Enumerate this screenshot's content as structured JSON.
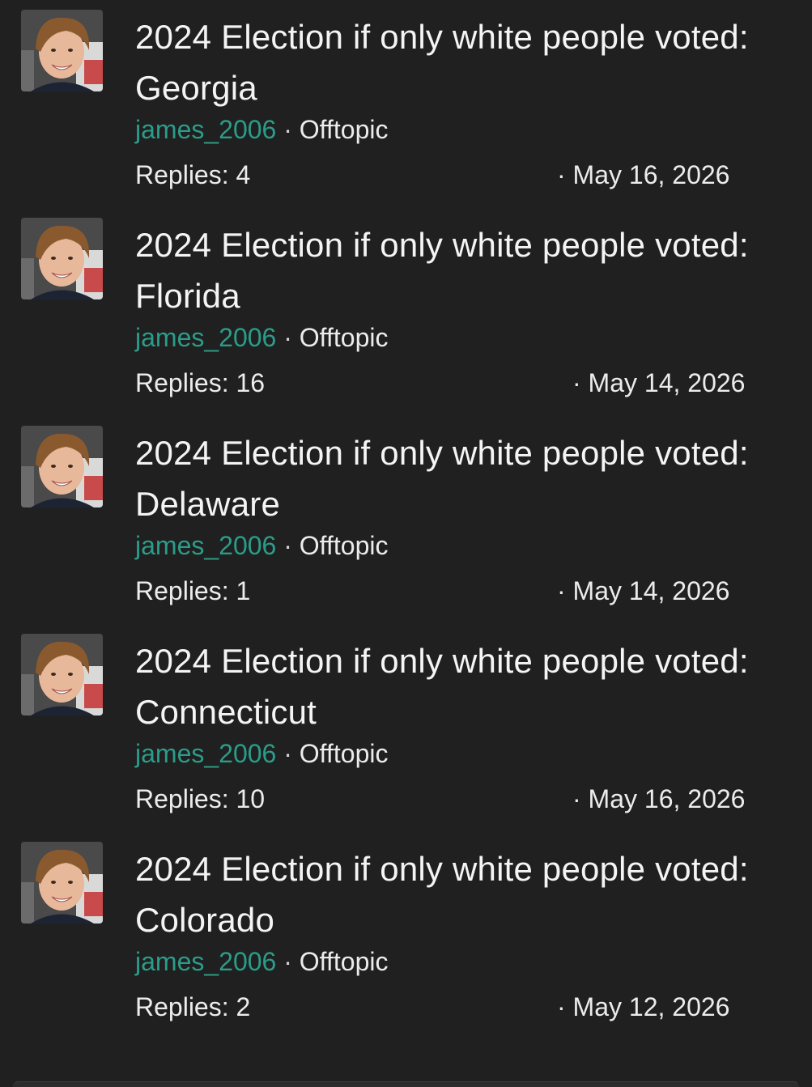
{
  "threads": [
    {
      "title_line1": "2024 Election if only white people voted:",
      "title_line2": "Georgia",
      "author": "james_2006",
      "separator": "·",
      "forum": "Offtopic",
      "replies": "Replies: 4",
      "date": "· May 16, 2026"
    },
    {
      "title_line1": "2024 Election if only white people voted:",
      "title_line2": "Florida",
      "author": "james_2006",
      "separator": "·",
      "forum": "Offtopic",
      "replies": "Replies: 16",
      "date": "· May 14, 2026"
    },
    {
      "title_line1": "2024 Election if only white people voted:",
      "title_line2": "Delaware",
      "author": "james_2006",
      "separator": "·",
      "forum": "Offtopic",
      "replies": "Replies: 1",
      "date": "· May 14, 2026"
    },
    {
      "title_line1": "2024 Election if only white people voted:",
      "title_line2": "Connecticut",
      "author": "james_2006",
      "separator": "·",
      "forum": "Offtopic",
      "replies": "Replies: 10",
      "date": "· May 16, 2026"
    },
    {
      "title_line1": "2024 Election if only white people voted:",
      "title_line2": "Colorado",
      "author": "james_2006",
      "separator": "·",
      "forum": "Offtopic",
      "replies": "Replies: 2",
      "date": "· May 12, 2026"
    }
  ],
  "colors": {
    "background": "#202020",
    "author_link": "#2a9d8a",
    "text": "#f4f4f4"
  },
  "icons": {
    "avatar": "user-avatar-photo"
  }
}
